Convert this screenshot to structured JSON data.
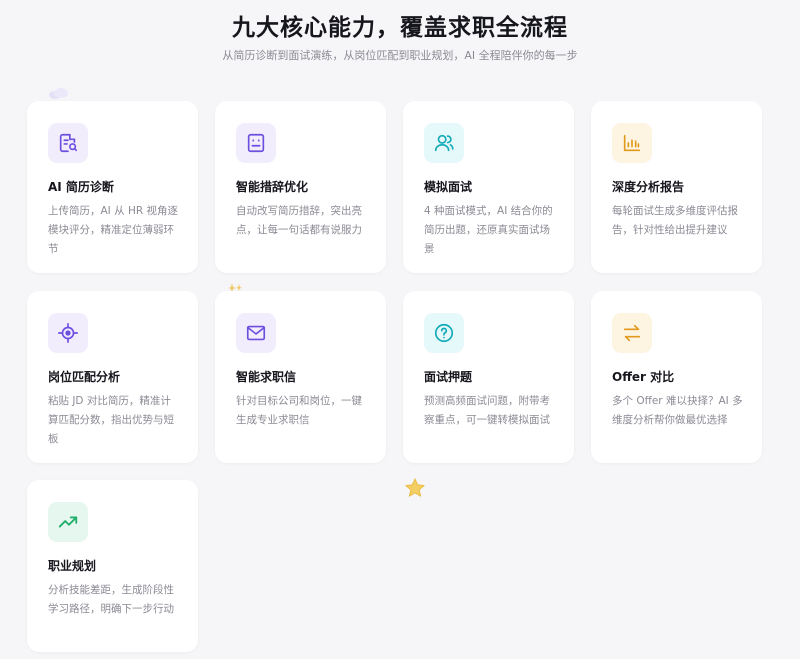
{
  "header": {
    "title": "九大核心能力，覆盖求职全流程",
    "subtitle": "从简历诊断到面试演练，从岗位匹配到职业规划，AI 全程陪伴你的每一步"
  },
  "features": [
    {
      "title": "AI 简历诊断",
      "desc": "上传简历，AI 从 HR 视角逐模块评分，精准定位薄弱环节",
      "icon": "resume-search-icon",
      "color": "#6d4fe0",
      "bg": "#f1edfd"
    },
    {
      "title": "智能措辞优化",
      "desc": "自动改写简历措辞，突出亮点，让每一句话都有说服力",
      "icon": "robot-icon",
      "color": "#6d4fe0",
      "bg": "#f1edfd"
    },
    {
      "title": "模拟面试",
      "desc": "4 种面试模式，AI 结合你的简历出题，还原真实面试场景",
      "icon": "users-icon",
      "color": "#11aab8",
      "bg": "#e5f8fa"
    },
    {
      "title": "深度分析报告",
      "desc": "每轮面试生成多维度评估报告，针对性给出提升建议",
      "icon": "bar-chart-icon",
      "color": "#e29a1e",
      "bg": "#fdf4e1"
    },
    {
      "title": "岗位匹配分析",
      "desc": "粘贴 JD 对比简历，精准计算匹配分数，指出优势与短板",
      "icon": "target-icon",
      "color": "#6d4fe0",
      "bg": "#f1edfd"
    },
    {
      "title": "智能求职信",
      "desc": "针对目标公司和岗位，一键生成专业求职信",
      "icon": "mail-icon",
      "color": "#6d4fe0",
      "bg": "#f1edfd"
    },
    {
      "title": "面试押题",
      "desc": "预测高频面试问题，附带考察重点，可一键转模拟面试",
      "icon": "question-icon",
      "color": "#11aab8",
      "bg": "#e5f8fa"
    },
    {
      "title": "Offer 对比",
      "desc": "多个 Offer 难以抉择？AI 多维度分析帮你做最优选择",
      "icon": "compare-arrows-icon",
      "color": "#e29a1e",
      "bg": "#fdf4e1"
    },
    {
      "title": "职业规划",
      "desc": "分析技能差距，生成阶段性学习路径，明确下一步行动",
      "icon": "trend-up-icon",
      "color": "#1fae6b",
      "bg": "#e5f7ee"
    }
  ]
}
